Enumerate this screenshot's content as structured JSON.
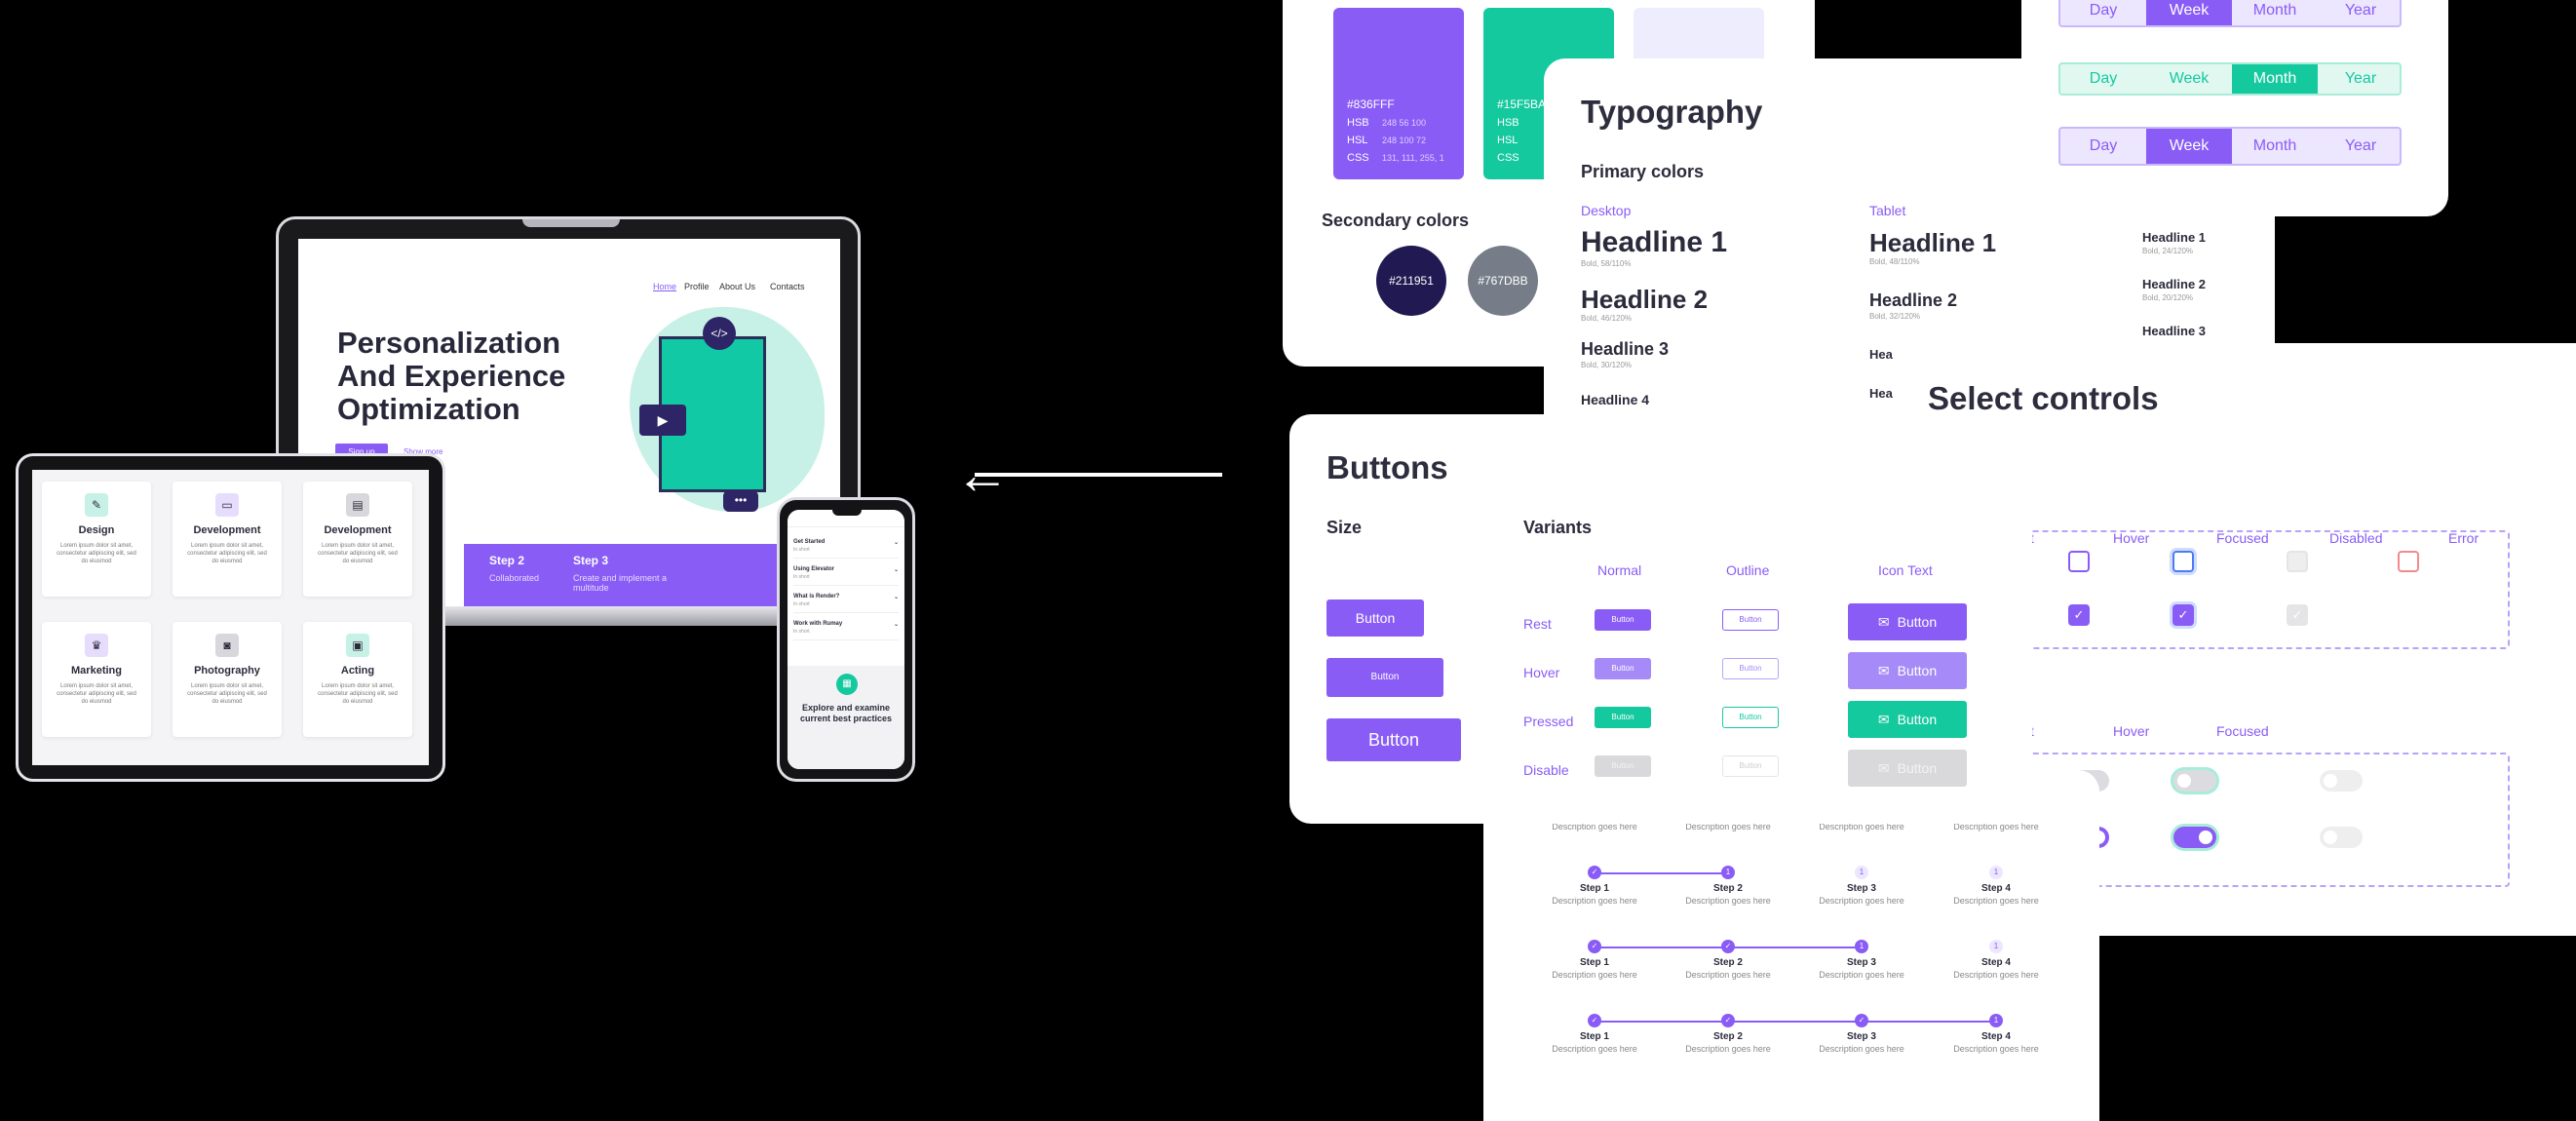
{
  "laptop": {
    "nav": [
      "Home",
      "Profile",
      "About Us",
      "Contacts"
    ],
    "hero_title": "Personalization And Experience Optimization",
    "signup": "Sign up",
    "show_more": "Show more",
    "step2_title": "Step 2",
    "step2_desc": "Collaborated",
    "step3_title": "Step 3",
    "step3_desc": "Create and implement a multitude"
  },
  "tablet": {
    "cards": [
      {
        "title": "Design",
        "icon": "pencil-icon",
        "text": "Lorem ipsum dolor sit amet, consectetur adipiscing elit, sed do eiusmod"
      },
      {
        "title": "Development",
        "icon": "monitor-icon",
        "text": "Lorem ipsum dolor sit amet, consectetur adipiscing elit, sed do eiusmod"
      },
      {
        "title": "Development",
        "icon": "server-icon",
        "text": "Lorem ipsum dolor sit amet, consectetur adipiscing elit, sed do eiusmod"
      },
      {
        "title": "Marketing",
        "icon": "crown-icon",
        "text": "Lorem ipsum dolor sit amet, consectetur adipiscing elit, sed do eiusmod"
      },
      {
        "title": "Photography",
        "icon": "camera-icon",
        "text": "Lorem ipsum dolor sit amet, consectetur adipiscing elit, sed do eiusmod"
      },
      {
        "title": "Acting",
        "icon": "image-icon",
        "text": "Lorem ipsum dolor sit amet, consectetur adipiscing elit, sed do eiusmod"
      }
    ]
  },
  "phone": {
    "items": [
      {
        "title": "Get Started",
        "sub": "In short"
      },
      {
        "title": "Using Elevator",
        "sub": "In short"
      },
      {
        "title": "What is Render?",
        "sub": "In short"
      },
      {
        "title": "Work with Rumay",
        "sub": "In short"
      }
    ],
    "caption": "Explore and examine current best practices"
  },
  "colors": {
    "swatches": [
      {
        "hex": "#836FFF",
        "hsb": "248 56 100",
        "hsl": "248 100 72",
        "css": "131, 111, 255, 1"
      },
      {
        "hex": "#15F5BA",
        "hsb": "",
        "hsl": "",
        "css": ""
      }
    ],
    "hsb_label": "HSB",
    "hsl_label": "HSL",
    "css_label": "CSS",
    "secondary_title": "Secondary colors",
    "secondary": [
      "#211951",
      "#767DBB"
    ]
  },
  "typography": {
    "title": "Typography",
    "primary": "Primary colors",
    "desktop": "Desktop",
    "tablet": "Tablet",
    "desktop_rows": [
      {
        "h": "Headline 1",
        "s": "Bold, 58/110%"
      },
      {
        "h": "Headline 2",
        "s": "Bold, 46/120%"
      },
      {
        "h": "Headline 3",
        "s": "Bold, 30/120%"
      },
      {
        "h": "Headline 4",
        "s": ""
      }
    ],
    "tablet_rows": [
      {
        "h": "Headline 1",
        "s": "Bold, 48/110%"
      },
      {
        "h": "Headline 2",
        "s": "Bold, 32/120%"
      },
      {
        "h": "Hea",
        "s": ""
      },
      {
        "h": "Hea",
        "s": ""
      }
    ],
    "mobile_rows": [
      {
        "h": "Headline 1",
        "s": "Bold, 24/120%"
      },
      {
        "h": "Headline 2",
        "s": "Bold, 20/120%"
      },
      {
        "h": "Headline 3",
        "s": ""
      }
    ]
  },
  "tabs": {
    "labels": [
      "Day",
      "Week",
      "Month",
      "Year"
    ]
  },
  "select": {
    "title": "Select controls",
    "cols1": [
      "Hover",
      "Focused",
      "Disabled",
      "Error"
    ],
    "partial1": "ult",
    "cols2": [
      "Hover",
      "Focused"
    ],
    "partial2": "ult"
  },
  "buttons": {
    "title": "Buttons",
    "size": "Size",
    "variants": "Variants",
    "col_normal": "Normal",
    "col_outline": "Outline",
    "col_icon": "Icon Text",
    "rows": [
      "Rest",
      "Hover",
      "Pressed",
      "Disable"
    ],
    "btn": "Button"
  },
  "steps": {
    "names": [
      "Step 1",
      "Step 2",
      "Step 3",
      "Step 4"
    ],
    "desc": "Description goes here",
    "num": "1"
  },
  "arrow": "←"
}
